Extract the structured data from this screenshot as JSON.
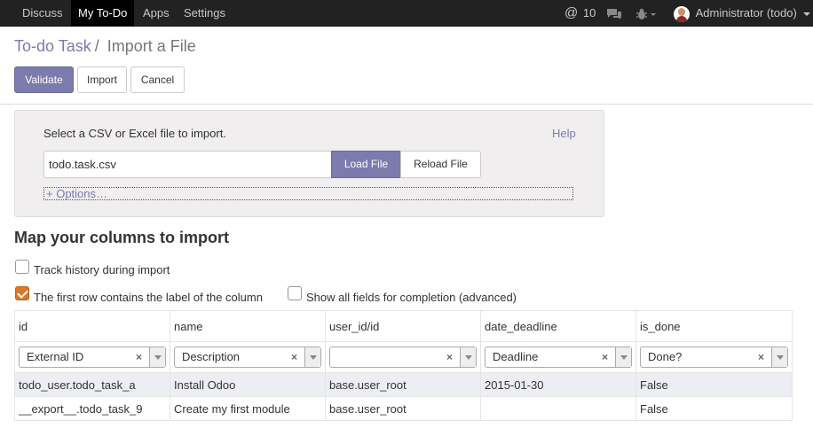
{
  "topbar": {
    "menu": [
      "Discuss",
      "My To-Do",
      "Apps",
      "Settings"
    ],
    "messages_count": "10",
    "user": "Administrator (todo)"
  },
  "breadcrumb": {
    "parent": "To-do Task",
    "separator": "/",
    "current": "Import a File"
  },
  "actions": {
    "validate": "Validate",
    "import": "Import",
    "cancel": "Cancel"
  },
  "panel": {
    "label": "Select a CSV or Excel file to import.",
    "help": "Help",
    "file_value": "todo.task.csv",
    "load_file": "Load File",
    "reload_file": "Reload File",
    "options": "+ Options…"
  },
  "mapping": {
    "title": "Map your columns to import",
    "track_history": {
      "label": "Track history during import",
      "checked": false
    },
    "first_row_header": {
      "label": "The first row contains the label of the column",
      "checked": true
    },
    "show_all_fields": {
      "label": "Show all fields for completion (advanced)",
      "checked": false
    }
  },
  "table": {
    "columns": [
      "id",
      "name",
      "user_id/id",
      "date_deadline",
      "is_done"
    ],
    "mapped_fields": [
      "External ID",
      "Description",
      "",
      "Deadline",
      "Done?"
    ],
    "clear_symbol": "×",
    "rows": [
      [
        "todo_user.todo_task_a",
        "Install Odoo",
        "base.user_root",
        "2015-01-30",
        "False"
      ],
      [
        "__export__.todo_task_9",
        "Create my first module",
        "base.user_root",
        "",
        "False"
      ]
    ]
  },
  "colors": {
    "accent": "#7c7bad",
    "topbar": "#222222",
    "checkbox_checked": "#d9772b"
  }
}
